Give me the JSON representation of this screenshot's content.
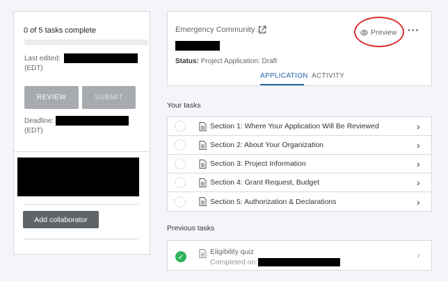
{
  "left_panel": {
    "progress_text": "0 of 5 tasks complete",
    "progress_fraction": 0,
    "last_edited_label": "Last edited:",
    "last_edited_tz": "(EDT)",
    "review_label": "REVIEW",
    "submit_label": "SUBMIT",
    "deadline_label": "Deadline:",
    "deadline_tz": "(EDT)",
    "add_collaborator_label": "Add collaborator"
  },
  "header": {
    "program_name": "Emergency Community ...",
    "preview_label": "Preview",
    "more_label": "···",
    "status_label": "Status:",
    "status_value": "Project Application: Draft",
    "tabs": [
      {
        "label": "APPLICATION",
        "active": true
      },
      {
        "label": "ACTIVITY",
        "active": false
      }
    ]
  },
  "your_tasks_heading": "Your tasks",
  "tasks": [
    {
      "label": "Section 1: Where Your Application Will Be Reviewed"
    },
    {
      "label": "Section 2: About Your Organization"
    },
    {
      "label": "Section 3: Project Information"
    },
    {
      "label": "Section 4: Grant Request, Budget"
    },
    {
      "label": "Section 5: Authorization & Declarations"
    }
  ],
  "previous_tasks_heading": "Previous tasks",
  "previous_tasks": [
    {
      "title": "Eligibility quiz",
      "completed_label": "Completed on:",
      "status": "complete"
    }
  ],
  "colors": {
    "accent": "#2563a8",
    "highlight_circle": "#d9302c",
    "complete": "#2fb35a"
  }
}
